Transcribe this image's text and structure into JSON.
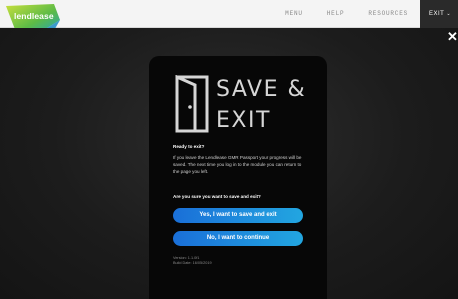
{
  "header": {
    "brand": "lendlease",
    "nav": [
      {
        "label": "MENU"
      },
      {
        "label": "HELP"
      },
      {
        "label": "RESOURCES"
      }
    ],
    "exit_label": "EXIT"
  },
  "dialog": {
    "hero_line1": "SAVE &",
    "hero_line2": "EXIT",
    "heading": "Ready to exit?",
    "body": "If you leave the Lendlease GMR Passport your progress will be saved. The next time you log in to the module you can return to the page you left.",
    "question": "Are you sure you want to save and exit?",
    "save_button": "Yes, I want to save and exit",
    "continue_button": "No, I want to continue",
    "version": "Version: 1.1.0f1",
    "build_date": "Build Date: 16/05/2019"
  },
  "colors": {
    "accent_start": "#1a6fd8",
    "accent_end": "#22a6e0",
    "logo_green": "#7ec142",
    "logo_blue": "#1aa0c8"
  },
  "icons": {
    "close": "close-icon",
    "door": "door-exit-icon",
    "chevron": "chevron-down-icon"
  }
}
